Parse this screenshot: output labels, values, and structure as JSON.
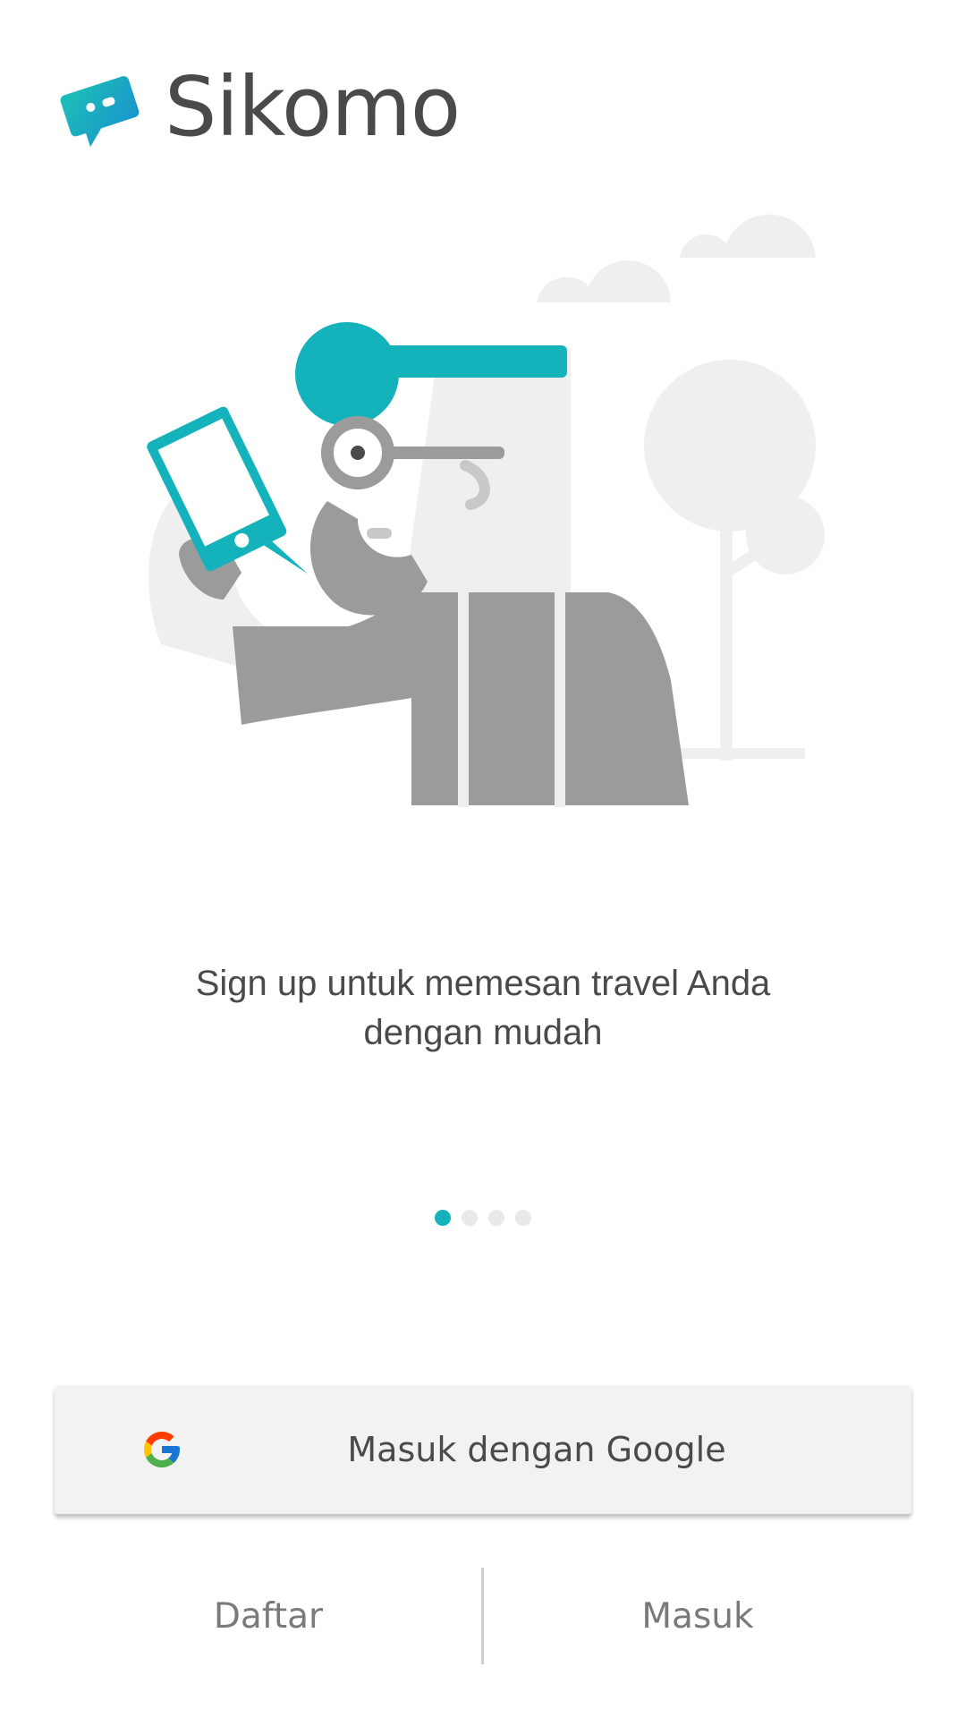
{
  "app": {
    "name": "Sikomo"
  },
  "onboarding": {
    "caption_line1": "Sign up untuk memesan travel Anda",
    "caption_line2": "dengan mudah",
    "page_count": 4,
    "active_page": 1
  },
  "actions": {
    "google_label": "Masuk dengan Google",
    "register_label": "Daftar",
    "login_label": "Masuk"
  },
  "colors": {
    "accent": "#14b3bb",
    "illustration_gray": "#9b9b9b",
    "background_shapes": "#efefef"
  }
}
